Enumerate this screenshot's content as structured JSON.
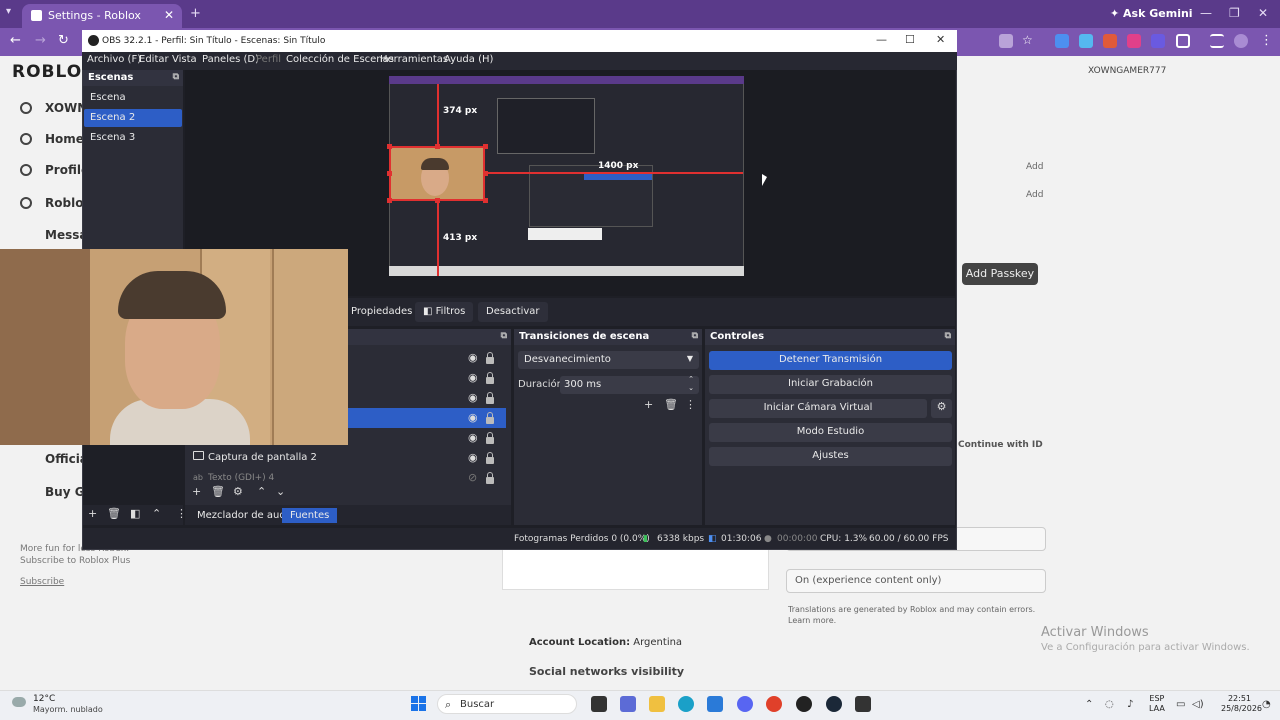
{
  "browser": {
    "tab_title": "Settings - Roblox",
    "ask_gemini": "Ask Gemini"
  },
  "roblox": {
    "logo": "ROBLOX",
    "nav": [
      "XOWN",
      "Home",
      "Profile",
      "Roblox",
      "Messag"
    ],
    "nav_lower": [
      "Official",
      "Buy Gift"
    ],
    "username": "XOWNGAMER777",
    "add_labels": [
      "Add",
      "Add"
    ],
    "add_passkey": "Add Passkey",
    "continue_id": "Continue with ID",
    "experience_option": "On (experience content only)",
    "translations_note": "Translations are generated by Roblox and may contain errors. Learn more.",
    "account_location_label": "Account Location:",
    "account_location_value": "Argentina",
    "social_visibility": "Social networks visibility",
    "more_fun": "More fun for less Robux. Subscribe to Roblox Plus",
    "subscribe": "Subscribe"
  },
  "activate_windows": {
    "title": "Activar Windows",
    "subtitle": "Ve a Configuración para activar Windows."
  },
  "obs": {
    "title": "OBS 32.2.1 - Perfil: Sin Título - Escenas: Sin Título",
    "menu": [
      "Archivo (F)",
      "Editar",
      "Vista",
      "Paneles (D)",
      "Perfil",
      "Colección de Escenas",
      "Herramientas",
      "Ayuda (H)"
    ],
    "scenes_header": "Escenas",
    "scenes": [
      "Escena",
      "Escena 2",
      "Escena 3"
    ],
    "selected_scene_index": 1,
    "preview_measures": {
      "top": "374 px",
      "right": "1400 px",
      "bottom": "413 px"
    },
    "tab_buttons": [
      "Propiedades",
      "Filtros",
      "Desactivar"
    ],
    "sources": [
      {
        "name": "",
        "visible": true,
        "locked": true
      },
      {
        "name": "",
        "visible": true,
        "locked": true
      },
      {
        "name": "",
        "visible": true,
        "locked": true
      },
      {
        "name": "",
        "visible": true,
        "locked": true,
        "selected": true
      },
      {
        "name": "",
        "visible": true,
        "locked": true
      },
      {
        "name": "Captura de pantalla 2",
        "visible": true,
        "locked": true
      },
      {
        "name": "Texto (GDI+) 4",
        "visible": false,
        "locked": true
      }
    ],
    "bottom_tabs": [
      "Mezclador de audio",
      "Fuentes"
    ],
    "transitions": {
      "header": "Transiciones de escena",
      "selected": "Desvanecimiento",
      "duration_label": "Duración",
      "duration_value": "300 ms"
    },
    "controls": {
      "header": "Controles",
      "stop_stream": "Detener Transmisión",
      "start_recording": "Iniciar Grabación",
      "start_vcam": "Iniciar Cámara Virtual",
      "studio_mode": "Modo Estudio",
      "settings": "Ajustes"
    },
    "status": {
      "dropped_frames": "Fotogramas Perdidos 0 (0.0%)",
      "bitrate": "6338 kbps",
      "stream_time": "01:30:06",
      "rec_time": "00:00:00",
      "cpu": "CPU: 1.3%",
      "fps": "60.00 / 60.00 FPS"
    }
  },
  "taskbar": {
    "temp": "12°C",
    "weather": "Mayorm. nublado",
    "search": "Buscar",
    "lang_1": "ESP",
    "lang_2": "LAA",
    "time": "22:51",
    "date": "25/8/2026"
  },
  "colors": {
    "obs_accent": "#2d5ec6",
    "chrome_purple": "#7b56b0",
    "selection_red": "#e03030"
  }
}
